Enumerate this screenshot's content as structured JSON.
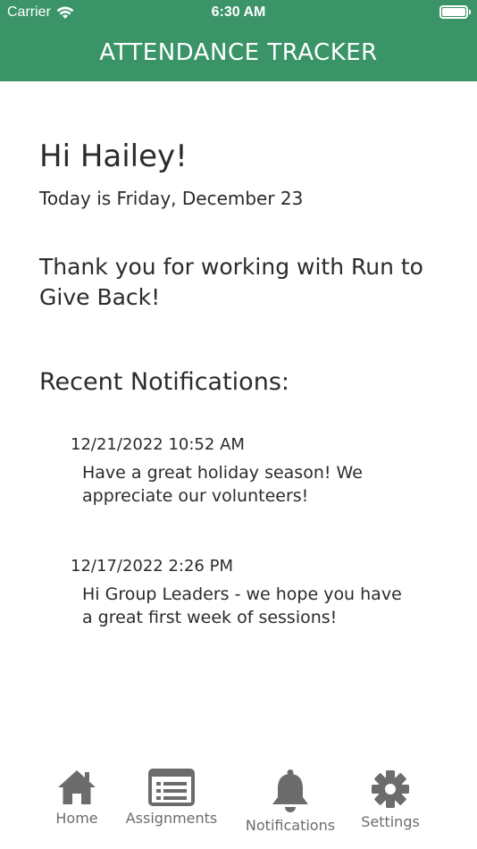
{
  "status_bar": {
    "carrier": "Carrier",
    "time": "6:30 AM"
  },
  "header": {
    "title": "ATTENDANCE TRACKER",
    "background_color": "#3a9468"
  },
  "main": {
    "greeting": "Hi Hailey!",
    "date_line": "Today is Friday, December 23",
    "thanks": "Thank you for working with Run to Give Back!",
    "recent_heading": "Recent Notifications:",
    "notifications": [
      {
        "timestamp": "12/21/2022 10:52 AM",
        "message": "Have a great holiday season! We appreciate our volunteers!"
      },
      {
        "timestamp": "12/17/2022 2:26 PM",
        "message": "Hi Group Leaders - we hope you have a great first week of sessions!"
      }
    ]
  },
  "tab_bar": {
    "items": [
      {
        "label": "Home",
        "icon": "home-icon"
      },
      {
        "label": "Assignments",
        "icon": "list-icon"
      },
      {
        "label": "Notifications",
        "icon": "bell-icon"
      },
      {
        "label": "Settings",
        "icon": "gear-icon"
      }
    ],
    "icon_color": "#6c6c6c"
  }
}
